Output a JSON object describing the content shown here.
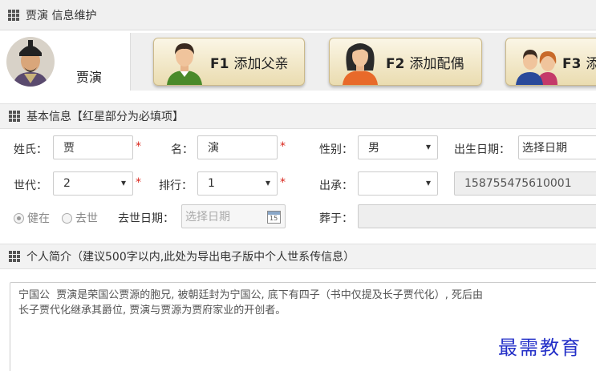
{
  "window": {
    "title": "贾演 信息维护"
  },
  "person": {
    "name": "贾演"
  },
  "actions": [
    {
      "key": "F1",
      "label": "添加父亲"
    },
    {
      "key": "F2",
      "label": "添加配偶"
    },
    {
      "key": "F3",
      "label": "添"
    }
  ],
  "basic_section": {
    "title": "基本信息【红星部分为必填项】"
  },
  "form": {
    "surname_label": "姓氏：",
    "surname_value": "贾",
    "given_label": "名：",
    "given_value": "演",
    "gender_label": "性别：",
    "gender_value": "男",
    "birth_label": "出生日期：",
    "birth_placeholder": "选择日期",
    "generation_label": "世代：",
    "generation_value": "2",
    "rank_label": "排行：",
    "rank_value": "1",
    "lineage_label": "出承：",
    "lineage_value": "",
    "id_value": "158755475610001",
    "alive_label": "健在",
    "deceased_label": "去世",
    "death_label": "去世日期：",
    "death_placeholder": "选择日期",
    "burial_label": "葬于：",
    "burial_value": "",
    "calendar_icon_text": "15"
  },
  "bio_section": {
    "title": "个人简介（建议500字以内,此处为导出电子版中个人世系传信息）"
  },
  "bio_text": "宁国公  贾演是荣国公贾源的胞兄, 被朝廷封为宁国公, 底下有四子（书中仅提及长子贾代化）, 死后由\n长子贾代化继承其爵位, 贾演与贾源为贾府家业的开创者。",
  "watermark": "最需教育",
  "colors": {
    "required": "#d9261c",
    "button_top": "#fbf6e6",
    "button_bottom": "#eadcb0",
    "watermark": "#2430c8"
  }
}
